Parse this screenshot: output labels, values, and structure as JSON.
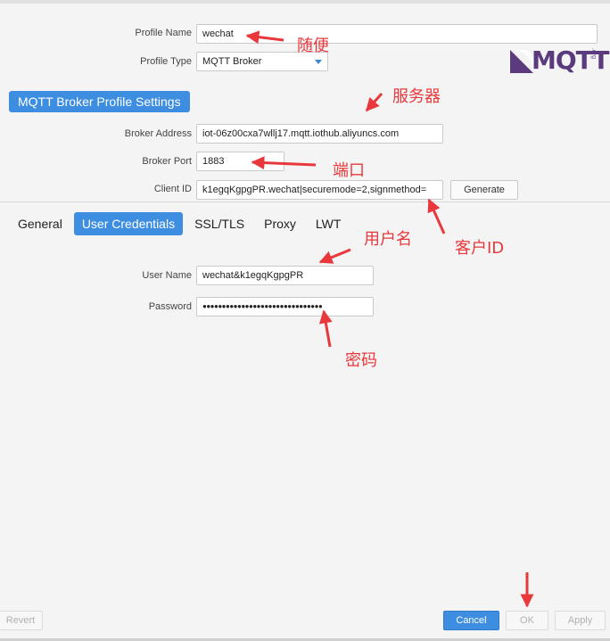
{
  "profile": {
    "name_label": "Profile Name",
    "name_value": "wechat",
    "type_label": "Profile Type",
    "type_value": "MQTT Broker"
  },
  "logo": {
    "text": "MQTT",
    "small": ".org"
  },
  "section": {
    "title": "MQTT Broker Profile Settings"
  },
  "broker": {
    "address_label": "Broker Address",
    "address_value": "iot-06z00cxa7wllj17.mqtt.iothub.aliyuncs.com",
    "port_label": "Broker Port",
    "port_value": "1883",
    "client_label": "Client ID",
    "client_value": "k1egqKgpgPR.wechat|securemode=2,signmethod=",
    "generate_label": "Generate"
  },
  "tabs": [
    "General",
    "User Credentials",
    "SSL/TLS",
    "Proxy",
    "LWT"
  ],
  "credentials": {
    "username_label": "User Name",
    "username_value": "wechat&k1egqKgpgPR",
    "password_label": "Password",
    "password_value": "●●●●●●●●●●●●●●●●●●●●●●●●●●●●●●●"
  },
  "footer": {
    "revert": "Revert",
    "cancel": "Cancel",
    "ok": "OK",
    "apply": "Apply"
  },
  "annotations": {
    "name": "随便",
    "server": "服务器",
    "port": "端口",
    "client": "客户ID",
    "username": "用户名",
    "password": "密码"
  },
  "colors": {
    "accent": "#3d8ee0",
    "annotation": "#e8383c",
    "logo": "#5b3b7e"
  }
}
